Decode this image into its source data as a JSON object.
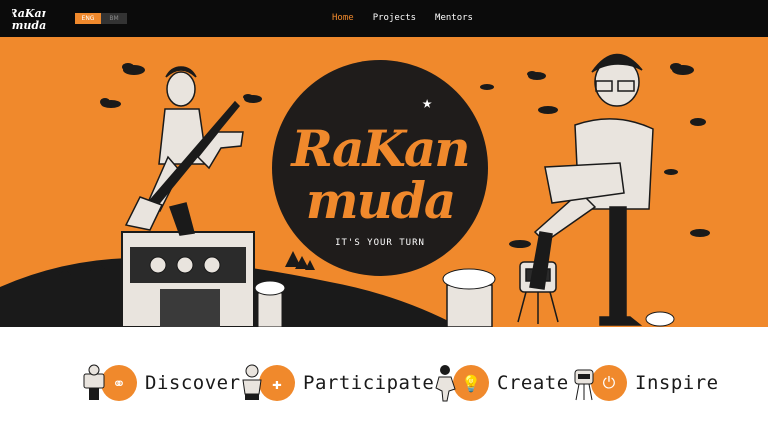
{
  "header": {
    "logo_text": "RaKan Muda",
    "languages": [
      {
        "label": "ENG",
        "active": true
      },
      {
        "label": "BM",
        "active": false
      }
    ],
    "nav": [
      {
        "label": "Home",
        "current": true
      },
      {
        "label": "Projects",
        "current": false
      },
      {
        "label": "Mentors",
        "current": false
      }
    ]
  },
  "hero": {
    "brand": "RaKan Muda",
    "tagline": "IT'S YOUR TURN"
  },
  "features": [
    {
      "label": "Discover",
      "icon": "binoculars-icon"
    },
    {
      "label": "Participate",
      "icon": "add-user-icon"
    },
    {
      "label": "Create",
      "icon": "lightbulb-icon"
    },
    {
      "label": "Inspire",
      "icon": "plug-icon"
    }
  ],
  "colors": {
    "accent": "#f0892c",
    "dark": "#1f1c1b",
    "topbar": "#0b0b0b"
  }
}
